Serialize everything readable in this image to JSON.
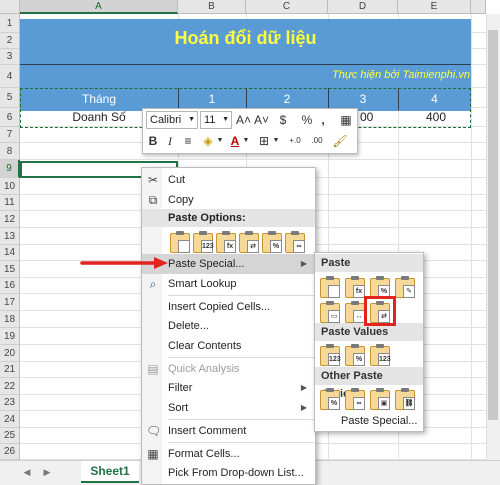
{
  "columns": [
    "A",
    "B",
    "C",
    "D",
    "E"
  ],
  "rows": [
    "1",
    "2",
    "3",
    "4",
    "5",
    "6",
    "7",
    "8",
    "9",
    "10",
    "11",
    "12",
    "13",
    "14",
    "15",
    "16",
    "17",
    "18",
    "19",
    "20",
    "21",
    "22",
    "23",
    "24",
    "25",
    "26"
  ],
  "sheet": {
    "title": "Hoán đổi dữ liệu",
    "subtitle": "Thực hiện bởi Taimienphi.vn",
    "header_row": [
      "Tháng",
      "1",
      "2",
      "3",
      "4"
    ],
    "data_row": {
      "label": "Doanh Số",
      "d": "00",
      "e": "400"
    }
  },
  "mini_toolbar": {
    "font": "Calibri",
    "size": "11",
    "grow_font": "A˄",
    "shrink_font": "A˅",
    "currency": "$",
    "percent": "%",
    "comma": ",",
    "bold": "B",
    "italic": "I",
    "align_icon": "≡",
    "font_color": "A",
    "dec_increase": "+.0",
    "dec_decrease": ".00"
  },
  "context_menu": {
    "cut": "Cut",
    "copy": "Copy",
    "paste_options": "Paste Options:",
    "paste_special": "Paste Special...",
    "smart_lookup": "Smart Lookup",
    "insert_copied": "Insert Copied Cells...",
    "delete": "Delete...",
    "clear_contents": "Clear Contents",
    "quick_analysis": "Quick Analysis",
    "filter": "Filter",
    "sort": "Sort",
    "insert_comment": "Insert Comment",
    "format_cells": "Format Cells...",
    "pick_dropdown": "Pick From Drop-down List..."
  },
  "paste_option_icons": [
    "paste-icon",
    "paste-values-icon",
    "paste-formulas-icon",
    "paste-transpose-icon",
    "paste-formatting-icon",
    "paste-link-icon"
  ],
  "submenu": {
    "paste": "Paste",
    "paste_values": "Paste Values",
    "other_options": "Other Paste Options",
    "paste_special": "Paste Special..."
  },
  "tabs": {
    "sheet1": "Sheet1"
  },
  "colors": {
    "band": "#5b9bd5",
    "title": "#ffff3b",
    "excel_green": "#217346",
    "highlight": "#e2241f"
  }
}
